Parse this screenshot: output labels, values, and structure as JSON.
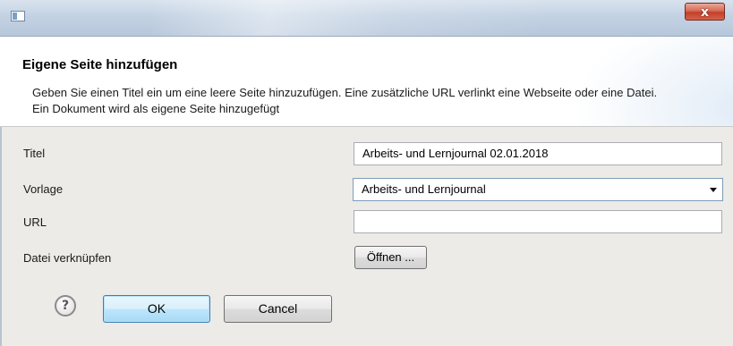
{
  "window": {
    "icon": "window-app-icon",
    "close_label": "x"
  },
  "header": {
    "title": "Eigene Seite hinzufügen",
    "description": "Geben Sie einen Titel ein um eine leere Seite hinzuzufügen. Eine zusätzliche URL verlinkt eine Webseite oder eine Datei. Ein Dokument wird als eigene Seite hinzugefügt"
  },
  "form": {
    "title_label": "Titel",
    "title_value": "Arbeits- und Lernjournal 02.01.2018",
    "template_label": "Vorlage",
    "template_value": "Arbeits- und Lernjournal",
    "url_label": "URL",
    "url_value": "",
    "file_label": "Datei verknüpfen",
    "open_button": "Öffnen ..."
  },
  "footer": {
    "help_symbol": "?",
    "ok_label": "OK",
    "cancel_label": "Cancel"
  },
  "colors": {
    "titlebar": "#c3d2e3",
    "close_button": "#c2402a",
    "dialog_background": "#ecebe7",
    "default_button": "#bee6fd"
  }
}
